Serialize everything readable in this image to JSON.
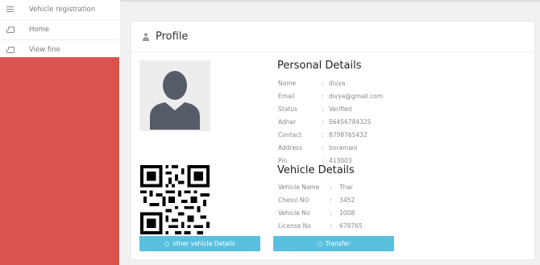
{
  "sidebar": {
    "items": [
      {
        "label": "Vehicle registration",
        "icon": "menu-icon"
      },
      {
        "label": "Home",
        "icon": "inbox-icon"
      },
      {
        "label": "View fine",
        "icon": "inbox-icon"
      }
    ],
    "accent_color": "#d9534f"
  },
  "profile": {
    "title": "Profile"
  },
  "personal": {
    "heading": "Personal Details",
    "rows": [
      {
        "key": "Name",
        "value": "divya"
      },
      {
        "key": "Email",
        "value": "divya@gmail.com"
      },
      {
        "key": "Status",
        "value": "Verified"
      },
      {
        "key": "Adhar",
        "value": "56456784325"
      },
      {
        "key": "Contact",
        "value": "8798765432"
      },
      {
        "key": "Address",
        "value": "boramani"
      },
      {
        "key": "Pin",
        "value": "413003"
      }
    ]
  },
  "vehicle": {
    "heading": "Vehicle Details",
    "rows": [
      {
        "key": "Vehicle Name",
        "value": "Thar"
      },
      {
        "key": "Chessi NO",
        "value": "3452"
      },
      {
        "key": "Vehicle No",
        "value": "1008"
      },
      {
        "key": "License No",
        "value": "678765"
      }
    ]
  },
  "separator": ":",
  "buttons": {
    "other_vehicle": "other vehicle Details",
    "transfer": "Transfer",
    "color": "#5bc0de"
  }
}
